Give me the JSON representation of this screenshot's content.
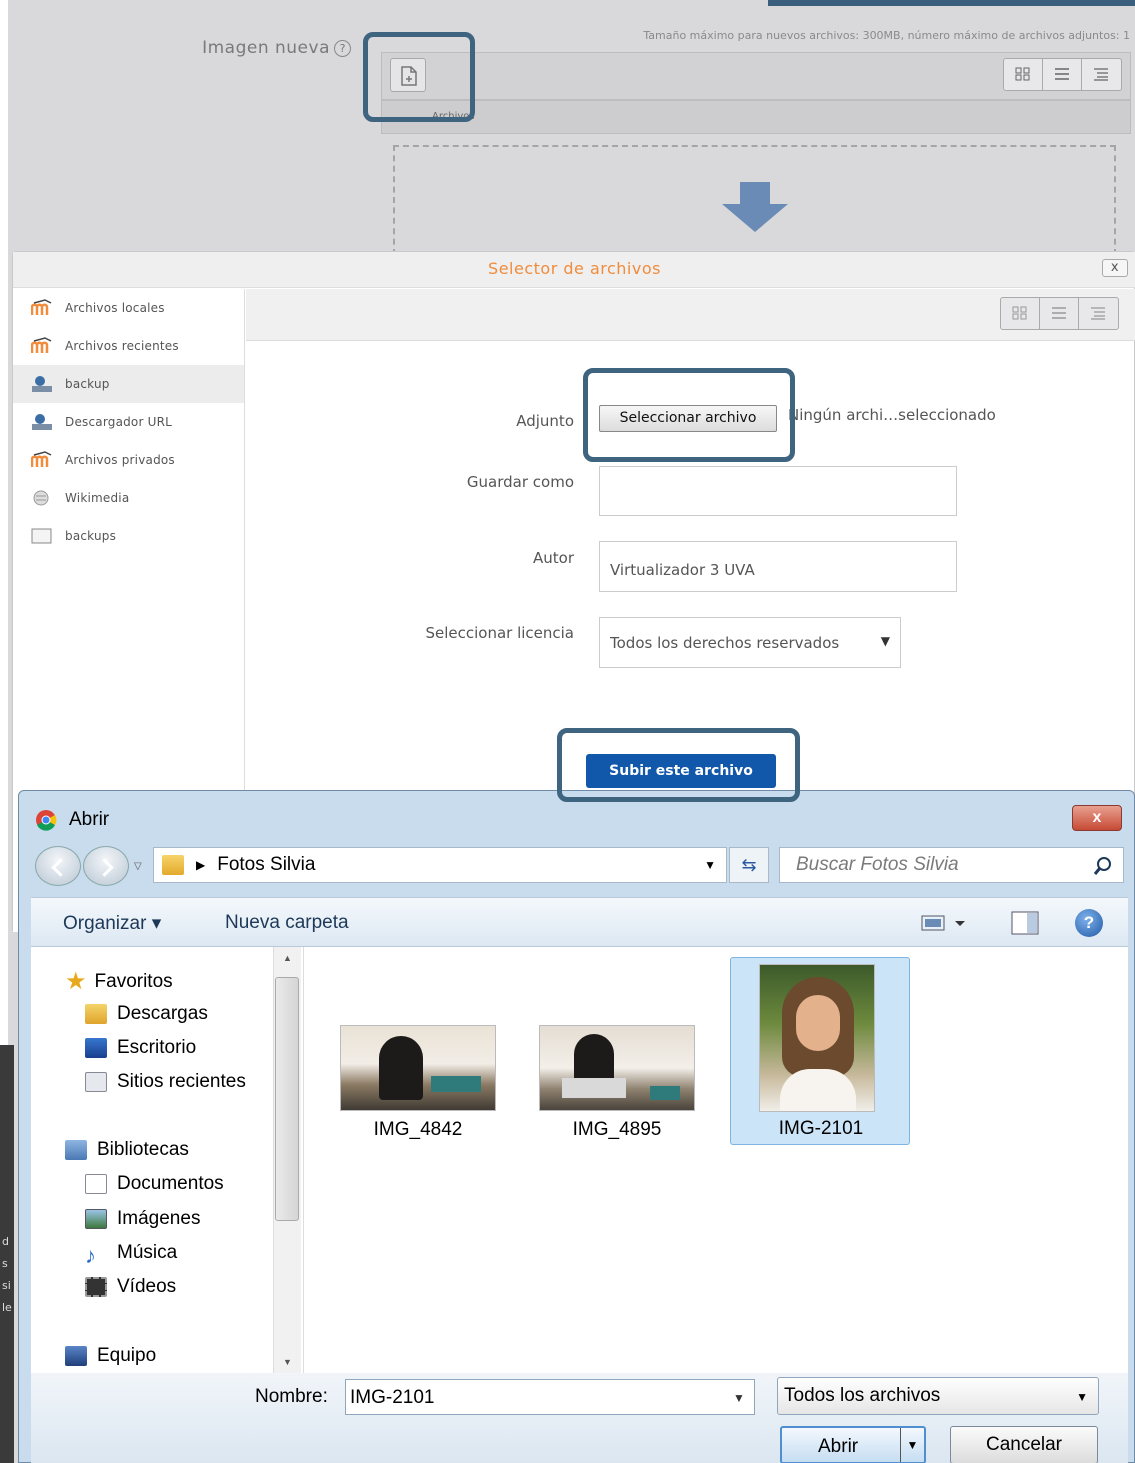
{
  "form": {
    "label": "Imagen nueva",
    "help": "?",
    "max_size": "Tamaño máximo para nuevos archivos: 300MB, número máximo de archivos adjuntos: 1",
    "path_label": "Archivos"
  },
  "picker": {
    "title": "Selector de archivos",
    "close": "x",
    "repositories": [
      {
        "label": "Archivos locales",
        "icon": "moodle-icon"
      },
      {
        "label": "Archivos recientes",
        "icon": "moodle-icon"
      },
      {
        "label": "backup",
        "icon": "backup-icon",
        "active": true
      },
      {
        "label": "Descargador URL",
        "icon": "backup-icon"
      },
      {
        "label": "Archivos privados",
        "icon": "moodle-icon"
      },
      {
        "label": "Wikimedia",
        "icon": "wikimedia-icon"
      },
      {
        "label": "backups",
        "icon": "folder-icon"
      }
    ],
    "attachment_label": "Adjunto",
    "choose_button": "Seleccionar archivo",
    "no_file": "Ningún archi…seleccionado",
    "save_as_label": "Guardar como",
    "save_as_value": "",
    "author_label": "Autor",
    "author_value": "Virtualizador 3 UVA",
    "license_label": "Seleccionar licencia",
    "license_value": "Todos los derechos reservados",
    "upload_button": "Subir este archivo"
  },
  "dialog": {
    "title": "Abrir",
    "close": "x",
    "address": "Fotos Silvia",
    "search_placeholder": "Buscar Fotos Silvia",
    "organize": "Organizar ▾",
    "new_folder": "Nueva carpeta",
    "help": "?",
    "nav": {
      "favorites": "Favoritos",
      "downloads": "Descargas",
      "desktop": "Escritorio",
      "recent": "Sitios recientes",
      "libraries": "Bibliotecas",
      "documents": "Documentos",
      "images": "Imágenes",
      "music": "Música",
      "videos": "Vídeos",
      "computer": "Equipo"
    },
    "files": [
      "IMG_4842",
      "IMG_4895",
      "IMG-2101"
    ],
    "selected_file": "IMG-2101",
    "name_label": "Nombre:",
    "name_value": "IMG-2101",
    "file_type": "Todos los archivos",
    "open_button": "Abrir",
    "cancel_button": "Cancelar"
  },
  "side_text": [
    "d",
    "s",
    "si",
    "le"
  ],
  "colors": {
    "accent_orange": "#f08c3c",
    "upload_blue": "#1158ab",
    "highlight": "#3f6480"
  }
}
